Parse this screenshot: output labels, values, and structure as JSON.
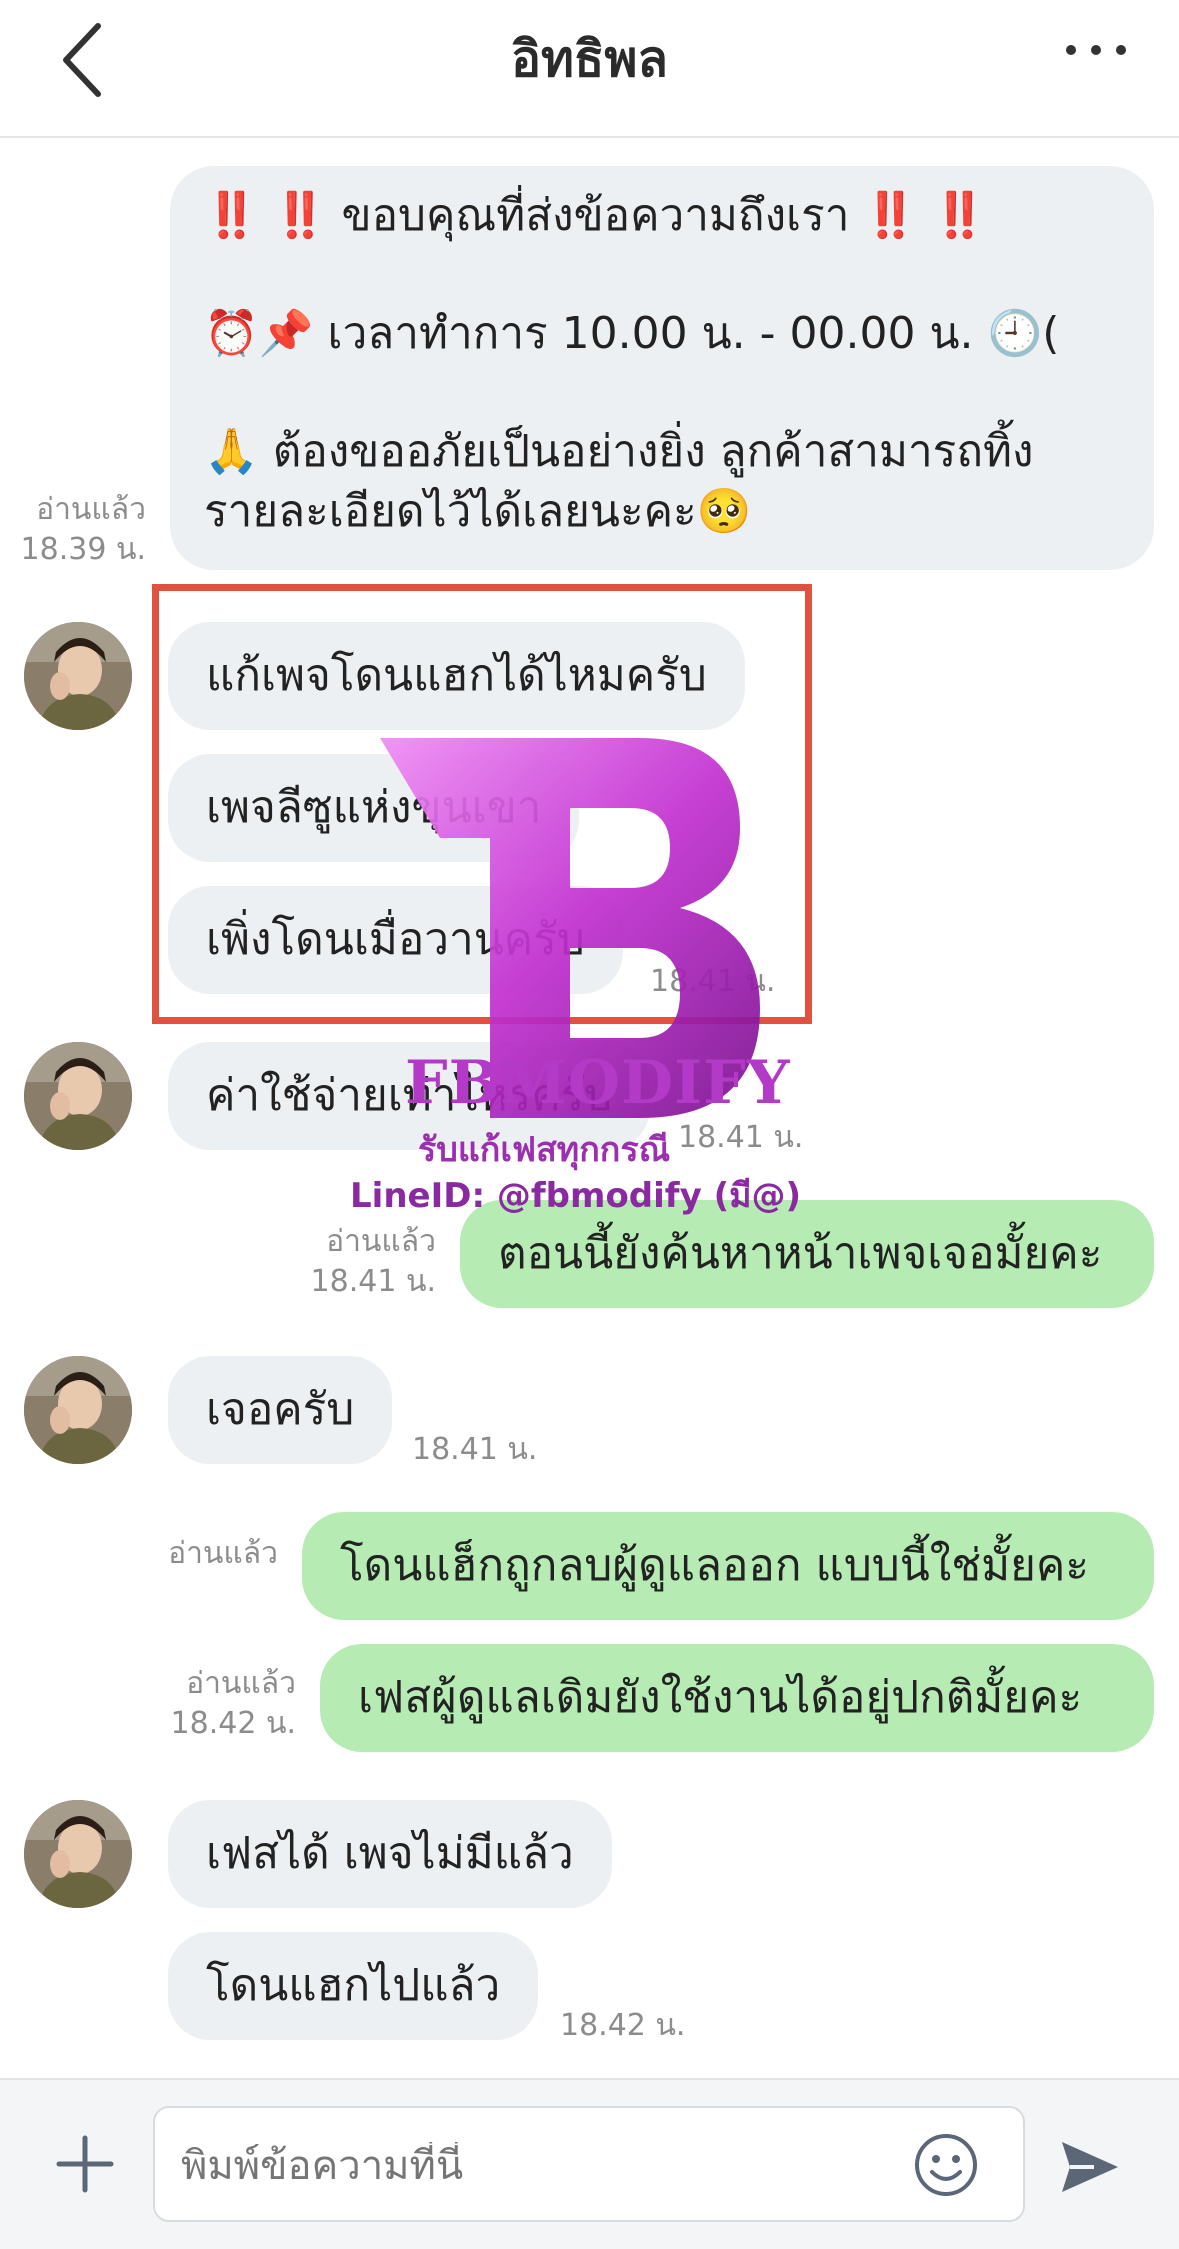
{
  "header": {
    "title": "อิทธิพล",
    "back_icon": "chevron-left-icon",
    "more_icon": "ellipsis-icon"
  },
  "welcome": {
    "line1": "‼️ ‼️ ขอบคุณที่ส่งข้อความถึงเรา ‼️ ‼️",
    "line2": "⏰📌 เวลาทำการ  10.00 น. -  00.00 น. 🕘(",
    "line3": "🙏 ต้องขออภัยเป็นอย่างยิ่ง ลูกค้าสามารถทิ้ง",
    "line4": "รายละเอียดไว้ได้เลยนะคะ🥺",
    "read": "อ่านแล้ว",
    "time": "18.39 น."
  },
  "messages": {
    "m1": "แก้เพจโดนแฮกได้ไหมครับ",
    "m2": "เพจลีซูแห่งขุนเขา",
    "m3": "เพิ่งโดนเมื่อวานครับ",
    "m3_time": "18.41 น.",
    "m4": "ค่าใช้จ่ายเท่าไหร่ครับ",
    "m4_time": "18.41 น.",
    "o1": "ตอนนี้ยังค้นหาหน้าเพจเจอมั้ยคะ",
    "o1_read": "อ่านแล้ว",
    "o1_time": "18.41 น.",
    "m5": "เจอครับ",
    "m5_time": "18.41 น.",
    "o2": "โดนแฮ็กถูกลบผู้ดูแลออก แบบนี้ใช่มั้ยคะ",
    "o2_read": "อ่านแล้ว",
    "o3": "เฟสผู้ดูแลเดิมยังใช้งานได้อยู่ปกติมั้ยคะ",
    "o3_read": "อ่านแล้ว",
    "o3_time": "18.42 น.",
    "m6": "เฟสได้ เพจไม่มีแล้ว",
    "m7": "โดนแฮกไปแล้ว",
    "m7_time": "18.42 น."
  },
  "watermark": {
    "brand": "FBMODIFY",
    "line1": "รับแก้เฟสทุกกรณี",
    "line2": "LineID: @fbmodify (มี@)"
  },
  "composer": {
    "placeholder": "พิมพ์ข้อความที่นี่",
    "plus_icon": "plus-icon",
    "emoji_icon": "emoji-icon",
    "send_icon": "send-icon"
  },
  "colors": {
    "incoming": "#edf0f2",
    "outgoing": "#b6ebb4",
    "highlight": "#e0513f",
    "watermark": "#b23ac6"
  }
}
